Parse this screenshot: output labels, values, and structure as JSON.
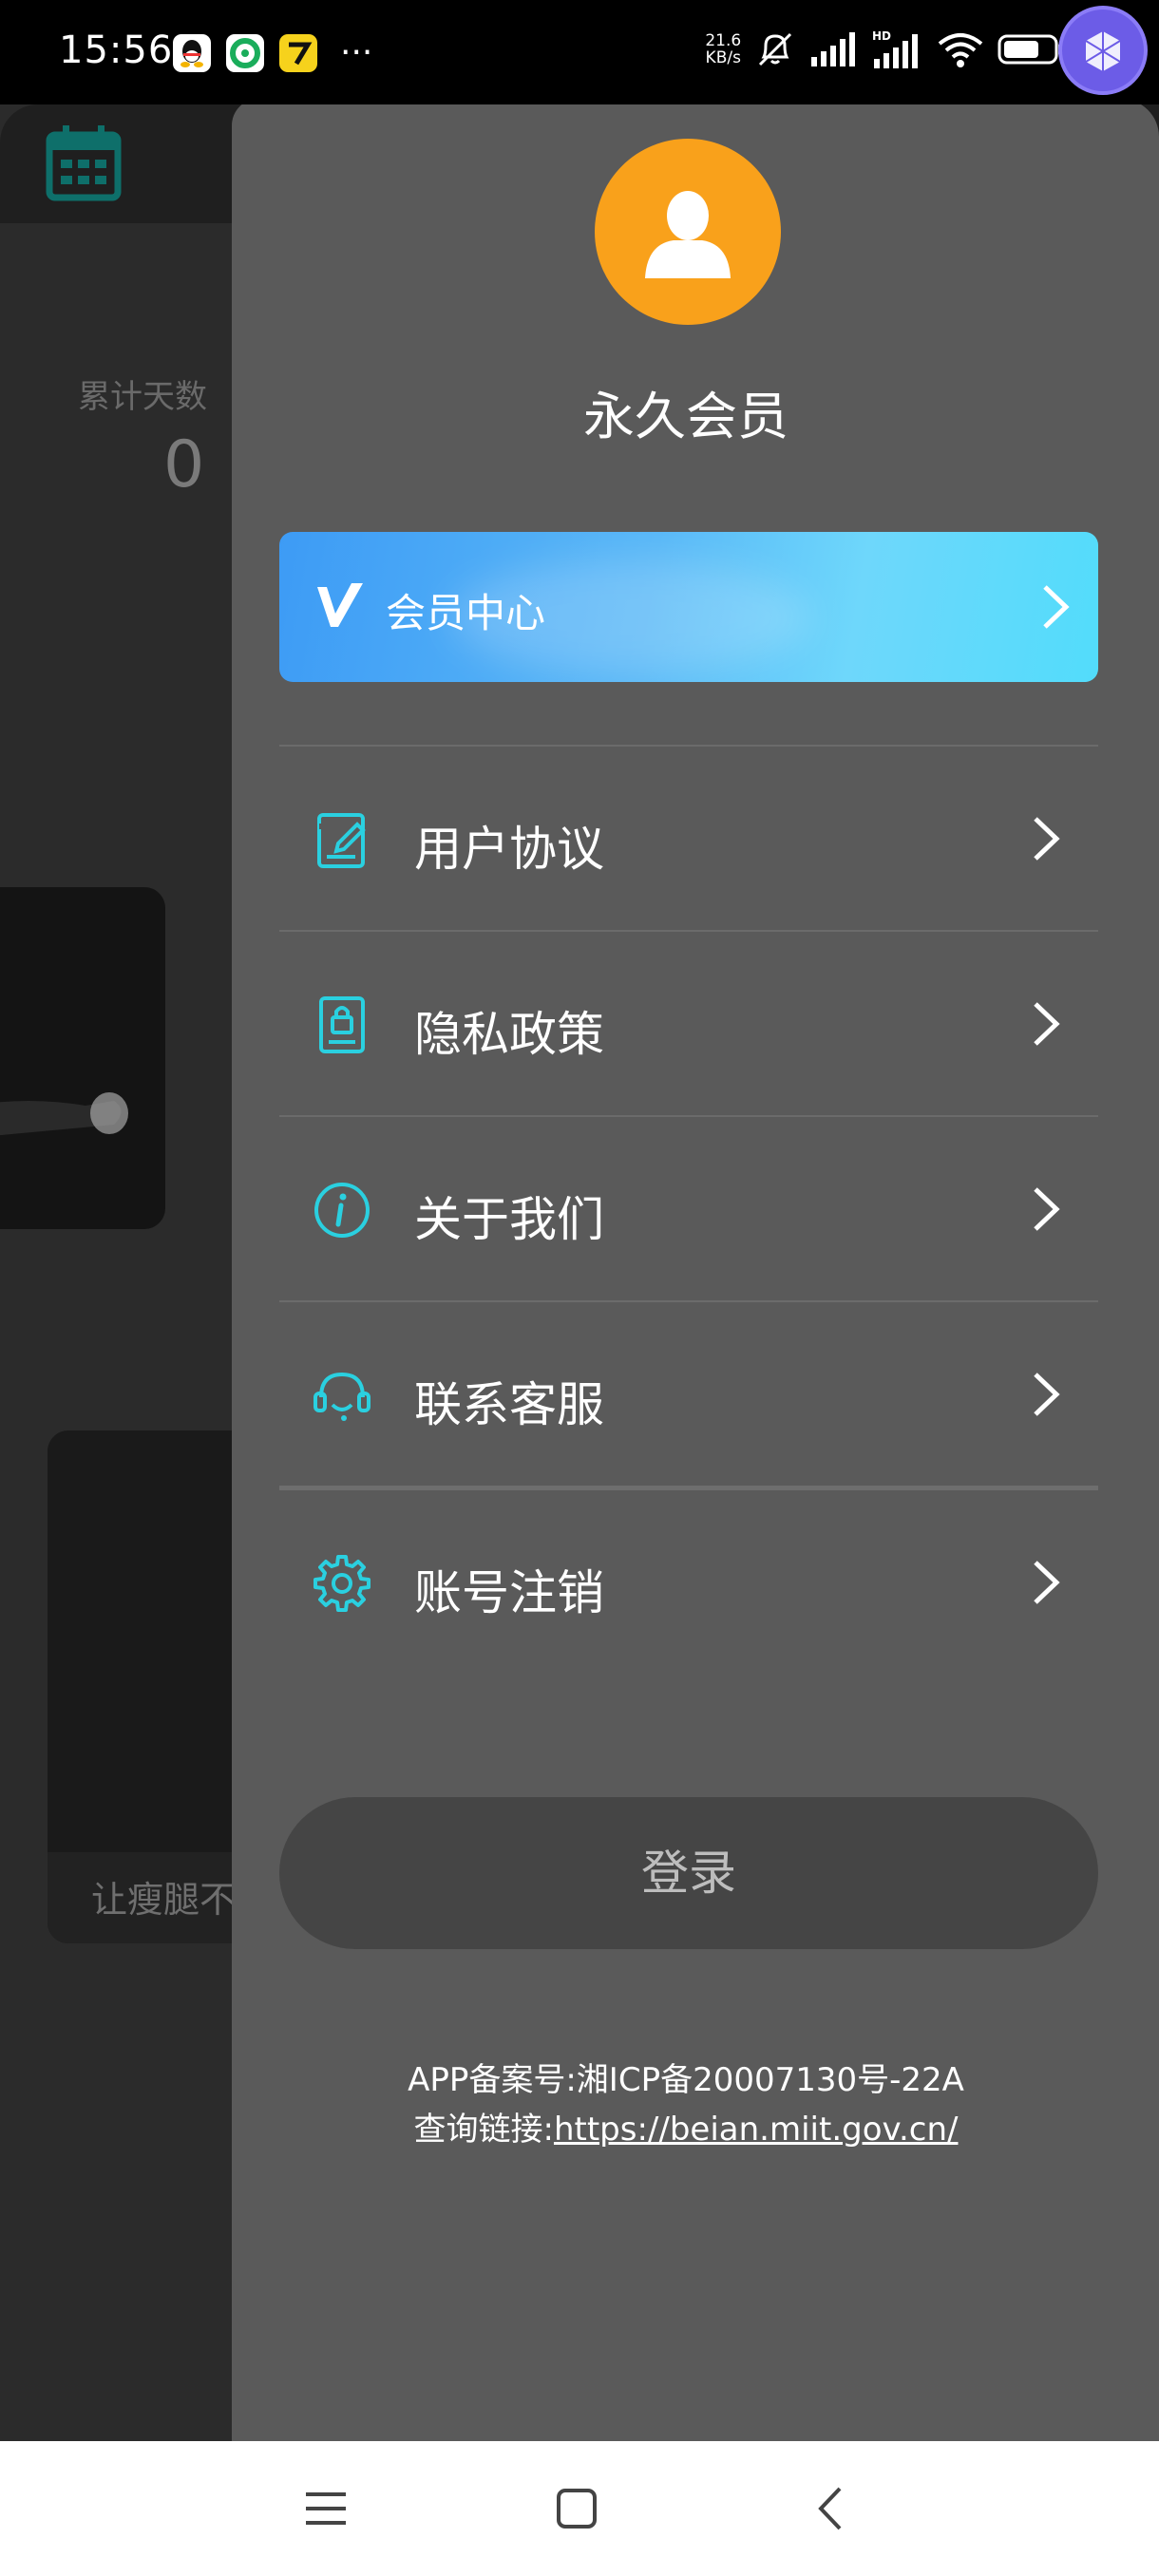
{
  "status_bar": {
    "time": "15:56",
    "net_speed_value": "21.6",
    "net_speed_unit": "KB/s",
    "battery_percent": "69"
  },
  "background_page": {
    "days_label": "累计天数",
    "days_value": "0",
    "card_label": "让瘦腿不"
  },
  "drawer": {
    "username": "永久会员",
    "vip_banner_label": "会员中心",
    "menu": [
      {
        "label": "用户协议",
        "icon": "edit-document-icon"
      },
      {
        "label": "隐私政策",
        "icon": "lock-document-icon"
      },
      {
        "label": "关于我们",
        "icon": "info-icon"
      },
      {
        "label": "联系客服",
        "icon": "headset-icon"
      },
      {
        "label": "账号注销",
        "icon": "gear-icon"
      }
    ],
    "login_label": "登录",
    "icp_line1": "APP备案号:湘ICP备20007130号-22A",
    "icp_line2_prefix": "查询链接:",
    "icp_link": "https://beian.miit.gov.cn/"
  },
  "colors": {
    "accent_cyan": "#2ad0e0",
    "avatar_orange": "#f9a11b",
    "drawer_bg": "#5a5a5a"
  }
}
